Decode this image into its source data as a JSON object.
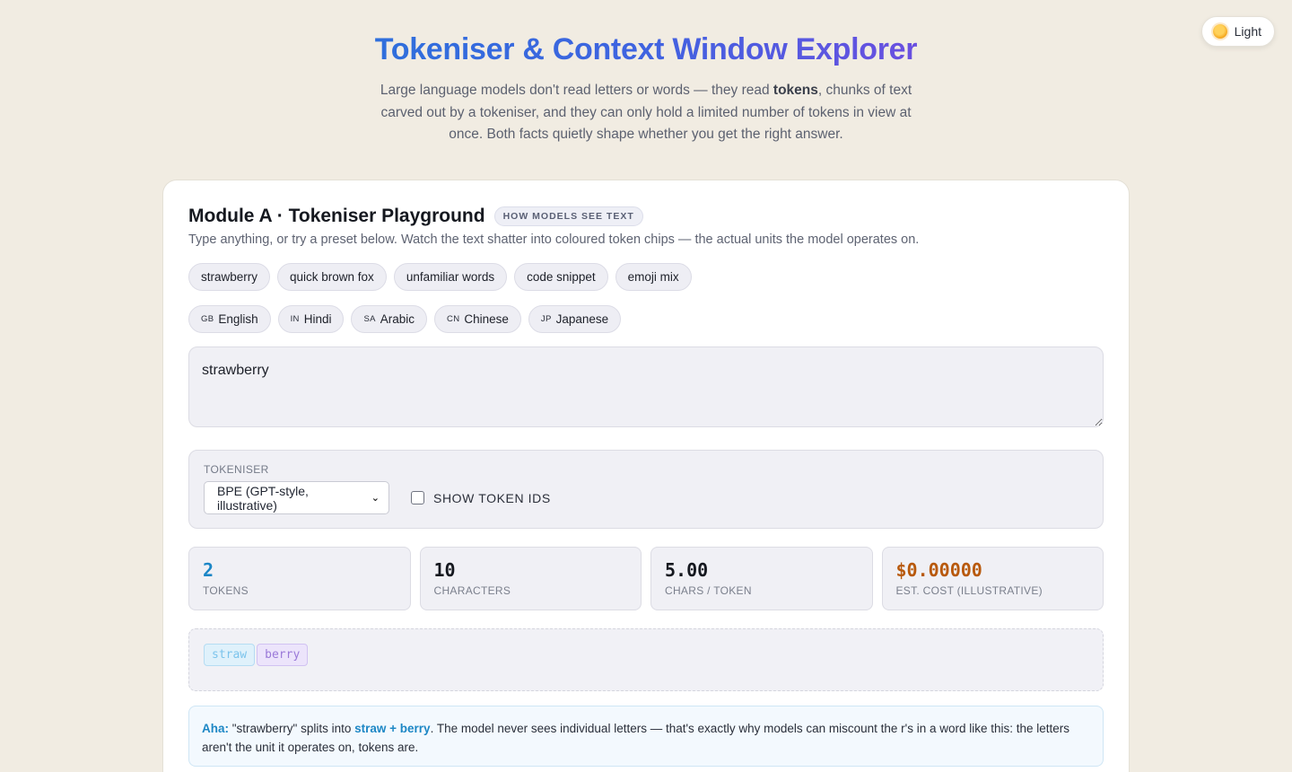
{
  "theme_toggle": {
    "label": "Light",
    "icon": "sun-icon"
  },
  "hero": {
    "title": "Tokeniser & Context Window Explorer",
    "intro_before": "Large language models don't read letters or words — they read ",
    "intro_bold": "tokens",
    "intro_after": ", chunks of text carved out by a tokeniser, and they can only hold a limited number of tokens in view at once. Both facts quietly shape whether you get the right answer."
  },
  "module": {
    "title": "Module A · Tokeniser Playground",
    "badge": "HOW MODELS SEE TEXT",
    "description": "Type anything, or try a preset below. Watch the text shatter into coloured token chips — the actual units the model operates on."
  },
  "presets": [
    "strawberry",
    "quick brown fox",
    "unfamiliar words",
    "code snippet",
    "emoji mix"
  ],
  "languages": [
    {
      "code": "GB",
      "label": "English"
    },
    {
      "code": "IN",
      "label": "Hindi"
    },
    {
      "code": "SA",
      "label": "Arabic"
    },
    {
      "code": "CN",
      "label": "Chinese"
    },
    {
      "code": "JP",
      "label": "Japanese"
    }
  ],
  "input": {
    "value": "strawberry"
  },
  "tokeniser": {
    "label": "TOKENISER",
    "selected": "BPE (GPT-style, illustrative)",
    "show_ids_label": "SHOW TOKEN IDS",
    "show_ids_checked": false
  },
  "stats": [
    {
      "value": "2",
      "label": "TOKENS",
      "color": "#1b86c6"
    },
    {
      "value": "10",
      "label": "CHARACTERS",
      "color": "#15181f"
    },
    {
      "value": "5.00",
      "label": "CHARS / TOKEN",
      "color": "#15181f"
    },
    {
      "value": "$0.00000",
      "label": "EST. COST (ILLUSTRATIVE)",
      "color": "#b8590c"
    }
  ],
  "tokens": [
    {
      "text": "straw",
      "color": "#7cc4ec",
      "bg": "#dff1fb",
      "border": "#b5dcf3"
    },
    {
      "text": "berry",
      "color": "#9a79d8",
      "bg": "#ece4fb",
      "border": "#d1c2f2"
    }
  ],
  "aha": {
    "lead": "Aha:",
    "part1": " \"strawberry\" splits into ",
    "token1": "straw",
    "plus": " + ",
    "token2": "berry",
    "part2": ". The model never sees individual letters — that's exactly why models can miscount the r's in a word like this: the letters aren't the unit it operates on, tokens are."
  }
}
